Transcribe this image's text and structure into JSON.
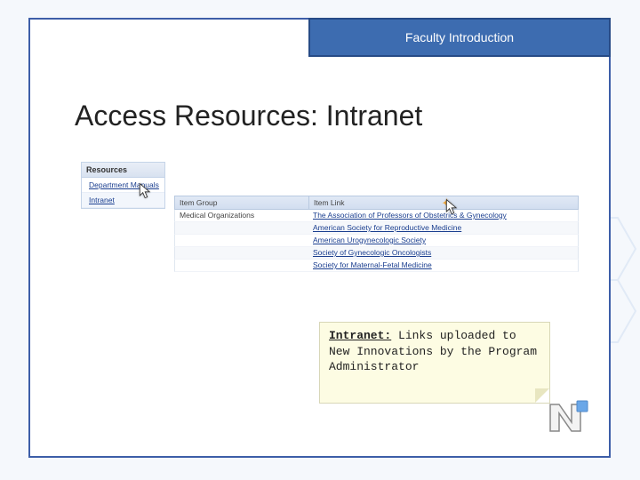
{
  "header": {
    "label": "Faculty Introduction"
  },
  "slide": {
    "title": "Access Resources: Intranet"
  },
  "sidebar": {
    "header": "Resources",
    "items": [
      {
        "label": "Department Manuals"
      },
      {
        "label": "Intranet"
      }
    ]
  },
  "table": {
    "columns": {
      "group": "Item Group",
      "link": "Item Link"
    },
    "rows": [
      {
        "group": "Medical Organizations",
        "link": "The Association of Professors of Obstetrics & Gynecology"
      },
      {
        "group": "",
        "link": "American Society for Reproductive Medicine"
      },
      {
        "group": "",
        "link": "American Urogynecologic Society"
      },
      {
        "group": "",
        "link": "Society of Gynecologic Oncologists"
      },
      {
        "group": "",
        "link": "Society for Maternal-Fetal Medicine"
      }
    ]
  },
  "callout": {
    "title": "Intranet:",
    "body": "Links uploaded to New Innovations by the Program Administrator"
  }
}
